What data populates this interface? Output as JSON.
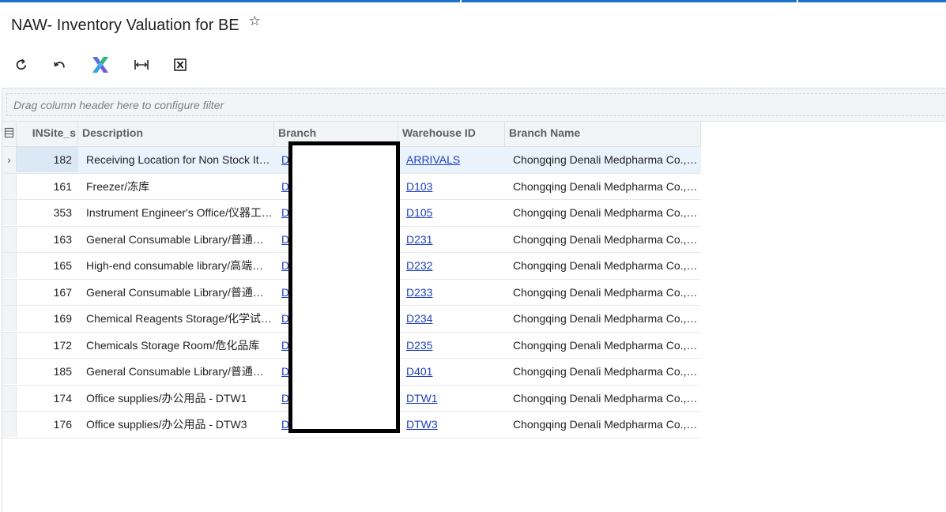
{
  "page": {
    "title": "NAW- Inventory Valuation for BE"
  },
  "toolbar": {
    "buttons": [
      {
        "name": "refresh-button",
        "icon": "refresh-icon"
      },
      {
        "name": "undo-button",
        "icon": "undo-icon"
      },
      {
        "name": "add-in-button",
        "icon": "puzzle-logo-icon"
      },
      {
        "name": "fit-columns-button",
        "icon": "fit-width-icon"
      },
      {
        "name": "export-excel-button",
        "icon": "excel-icon"
      }
    ]
  },
  "filter": {
    "placeholder": "Drag column header here to configure filter"
  },
  "grid": {
    "columns": [
      "INSite_s",
      "Description",
      "Branch",
      "Warehouse ID",
      "Branch Name"
    ],
    "rows": [
      {
        "site": "182",
        "description": "Receiving Location for Non Stock Items",
        "branch": "D",
        "warehouse": "ARRIVALS",
        "branch_name": "Chongqing Denali Medpharma Co., Ltd.",
        "selected": true
      },
      {
        "site": "161",
        "description": "Freezer/冻库",
        "branch": "D",
        "warehouse": "D103",
        "branch_name": "Chongqing Denali Medpharma Co., Ltd."
      },
      {
        "site": "353",
        "description": "Instrument Engineer's Office/仪器工程师办公室",
        "branch": "D",
        "warehouse": "D105",
        "branch_name": "Chongqing Denali Medpharma Co., Ltd."
      },
      {
        "site": "163",
        "description": "General Consumable Library/普通耗材库",
        "branch": "D",
        "warehouse": "D231",
        "branch_name": "Chongqing Denali Medpharma Co., Ltd."
      },
      {
        "site": "165",
        "description": "High-end consumable library/高端耗材库",
        "branch": "D",
        "warehouse": "D232",
        "branch_name": "Chongqing Denali Medpharma Co., Ltd."
      },
      {
        "site": "167",
        "description": "General Consumable Library/普通耗材库",
        "branch": "D",
        "warehouse": "D233",
        "branch_name": "Chongqing Denali Medpharma Co., Ltd."
      },
      {
        "site": "169",
        "description": "Chemical Reagents Storage/化学试剂库",
        "branch": "D",
        "warehouse": "D234",
        "branch_name": "Chongqing Denali Medpharma Co., Ltd."
      },
      {
        "site": "172",
        "description": "Chemicals Storage Room/危化品库",
        "branch": "D",
        "warehouse": "D235",
        "branch_name": "Chongqing Denali Medpharma Co., Ltd."
      },
      {
        "site": "185",
        "description": "General Consumable Library/普通耗材库",
        "branch": "D",
        "warehouse": "D401",
        "branch_name": "Chongqing Denali Medpharma Co., Ltd."
      },
      {
        "site": "174",
        "description": "Office supplies/办公用品 - DTW1",
        "branch": "D",
        "warehouse": "DTW1",
        "branch_name": "Chongqing Denali Medpharma Co., Ltd."
      },
      {
        "site": "176",
        "description": "Office supplies/办公用品 - DTW3",
        "branch": "D",
        "warehouse": "DTW3",
        "branch_name": "Chongqing Denali Medpharma Co., Ltd."
      }
    ]
  },
  "colors": {
    "accent": "#1a73c9",
    "link": "#1f3fbf",
    "selected_row": "#eaf3fb",
    "header_bg": "#f3f4f6"
  }
}
